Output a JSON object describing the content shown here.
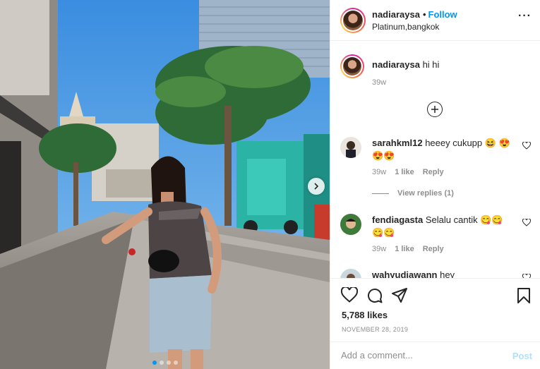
{
  "header": {
    "username": "nadiaraysa",
    "separator": "•",
    "follow_label": "Follow",
    "location": "Platinum,bangkok",
    "more_label": "···"
  },
  "caption": {
    "username": "nadiaraysa",
    "text": "hi hi",
    "time": "39w"
  },
  "comments": [
    {
      "username": "sarahkml12",
      "text": "heeey cukupp 😆 😍😍😍",
      "time": "39w",
      "likes": "1 like",
      "reply_label": "Reply",
      "view_replies": "View replies (1)"
    },
    {
      "username": "fendiagasta",
      "text": "Selalu cantik 😋😋 😋😋",
      "time": "39w",
      "likes": "1 like",
      "reply_label": "Reply"
    },
    {
      "username": "wahyudiawann",
      "text": "hey"
    }
  ],
  "actions": {
    "likes_count": "5,788 likes",
    "date": "NOVEMBER 28, 2019"
  },
  "add_comment": {
    "placeholder": "Add a comment...",
    "post_label": "Post"
  },
  "carousel": {
    "total": 4,
    "active_index": 0
  },
  "colors": {
    "accent": "#0095f6",
    "post_disabled": "#b2dffc",
    "muted": "#8e8e8e",
    "text": "#262626"
  }
}
